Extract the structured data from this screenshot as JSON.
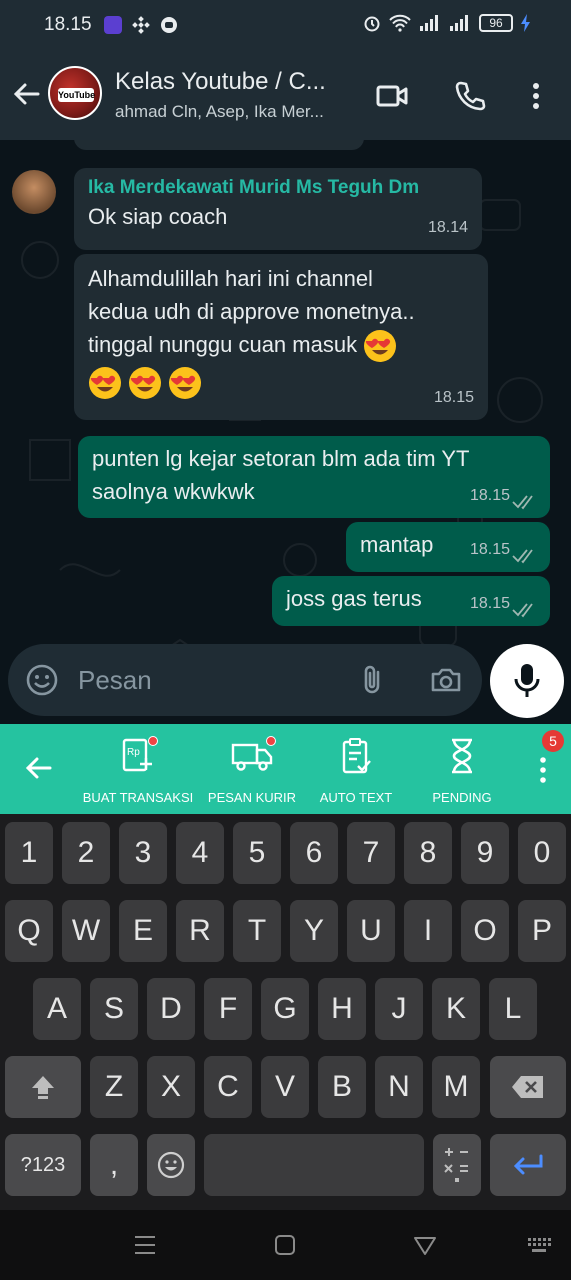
{
  "status_bar": {
    "time": "18.15",
    "battery": "96"
  },
  "header": {
    "title": "Kelas Youtube / C...",
    "subtitle": "ahmad Cln, Asep, Ika Mer...",
    "avatar_text": "YouTube"
  },
  "messages": [
    {
      "direction": "in",
      "sender": "Ika Merdekawati Murid Ms Teguh Dm",
      "text": "Ok siap coach",
      "time": "18.14"
    },
    {
      "direction": "in",
      "sender": "",
      "text_lines": [
        "Alhamdulillah hari ini channel",
        "kedua udh di approve monetnya..",
        "tinggal nunggu cuan masuk"
      ],
      "time": "18.15"
    },
    {
      "direction": "out",
      "text_lines": [
        "punten lg kejar setoran blm ada tim YT",
        "saolnya wkwkwk"
      ],
      "time": "18.15",
      "status": "read"
    },
    {
      "direction": "out",
      "text": "mantap",
      "time": "18.15",
      "status": "read"
    },
    {
      "direction": "out",
      "text": "joss gas terus",
      "time": "18.15",
      "status": "read"
    }
  ],
  "input": {
    "placeholder": "Pesan"
  },
  "toolbar": {
    "items": [
      {
        "label": "BUAT TRANSAKSI"
      },
      {
        "label": "PESAN KURIR"
      },
      {
        "label": "AUTO TEXT"
      },
      {
        "label": "PENDING"
      }
    ],
    "badge": "5"
  },
  "keyboard": {
    "row_numbers": [
      "1",
      "2",
      "3",
      "4",
      "5",
      "6",
      "7",
      "8",
      "9",
      "0"
    ],
    "row1": [
      "Q",
      "W",
      "E",
      "R",
      "T",
      "Y",
      "U",
      "I",
      "O",
      "P"
    ],
    "row2": [
      "A",
      "S",
      "D",
      "F",
      "G",
      "H",
      "J",
      "K",
      "L"
    ],
    "row3": [
      "Z",
      "X",
      "C",
      "V",
      "B",
      "N",
      "M"
    ],
    "sym_label": "?123",
    "comma": ","
  },
  "colors": {
    "incoming": "#202c33",
    "outgoing": "#005c4b",
    "accent": "#25c3a0",
    "sender": "#26b9a4"
  }
}
